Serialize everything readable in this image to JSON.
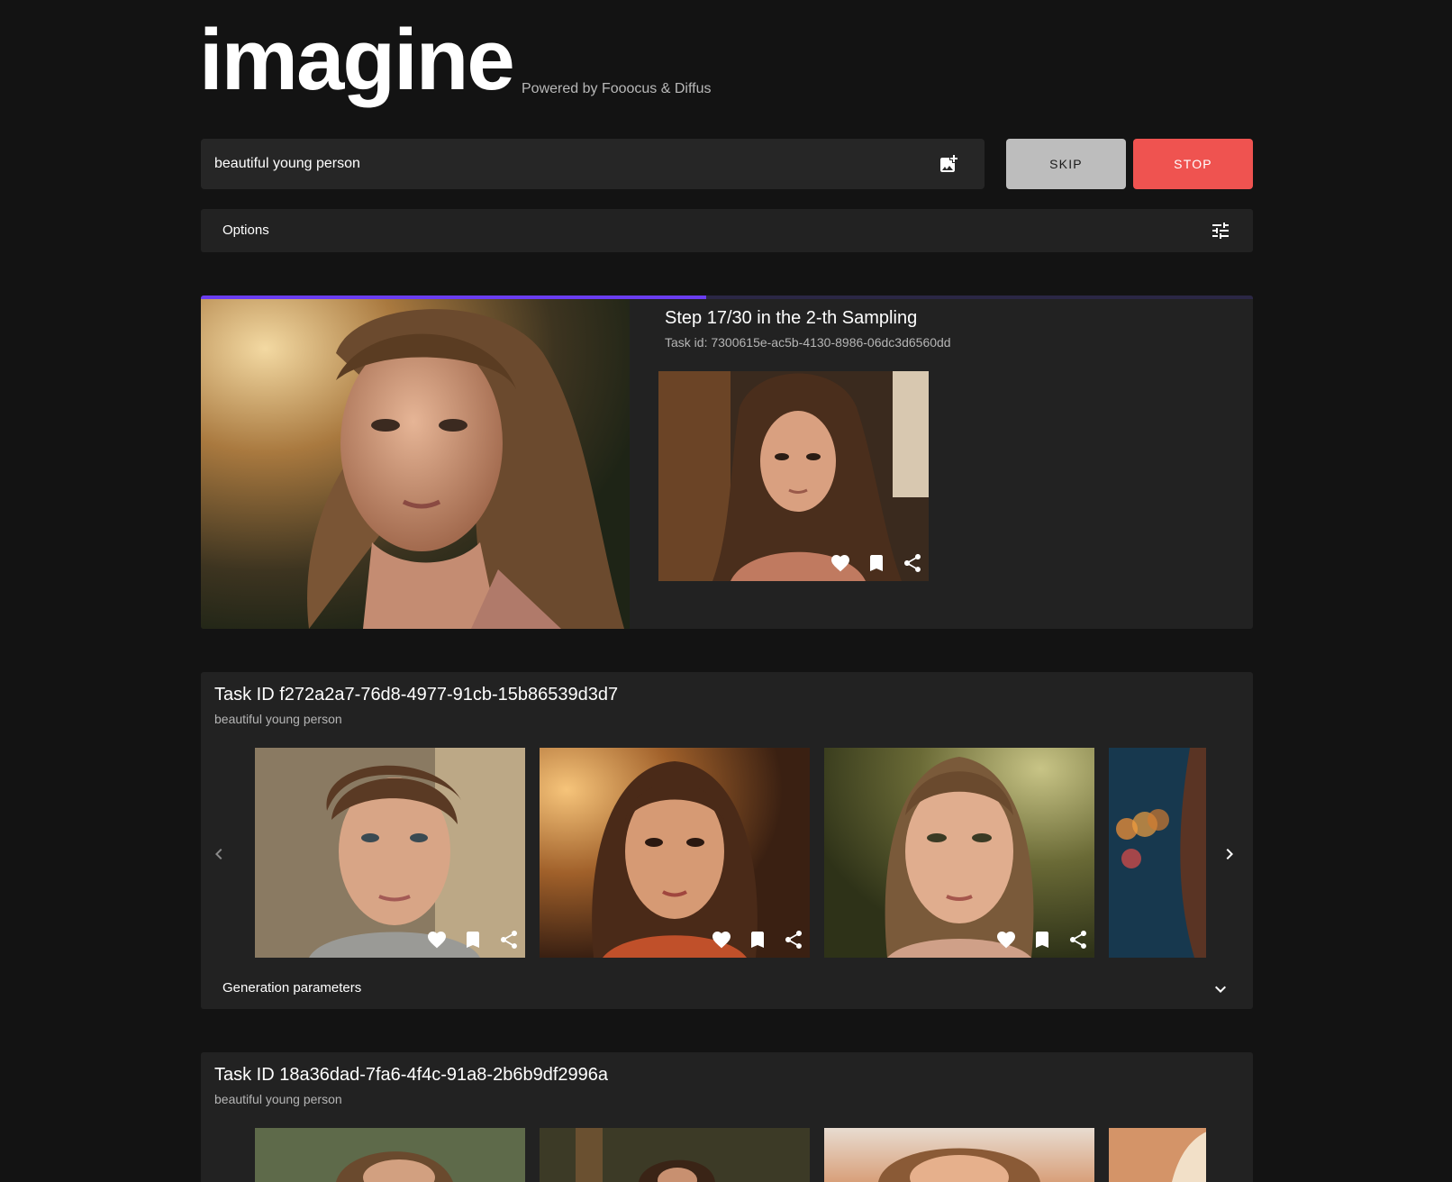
{
  "app": {
    "logo": "imagine",
    "powered_by": "Powered by Fooocus & Diffus"
  },
  "prompt": {
    "value": "beautiful young person",
    "add_image_icon": "add-photo-icon"
  },
  "buttons": {
    "skip": "SKIP",
    "stop": "STOP"
  },
  "options": {
    "label": "Options",
    "icon": "tune-icon"
  },
  "current_task": {
    "step_text": "Step 17/30 in the 2-th Sampling",
    "task_id_text": "Task id: 7300615e-ac5b-4130-8986-06dc3d6560dd",
    "progress_fraction": 0.48,
    "progress_color": "#6a3df0"
  },
  "tasks": [
    {
      "title": "Task ID f272a2a7-76d8-4977-91cb-15b86539d3d7",
      "prompt": "beautiful young person",
      "gen_params_label": "Generation parameters"
    },
    {
      "title": "Task ID 18a36dad-7fa6-4f4c-91a8-2b6b9df2996a",
      "prompt": "beautiful young person"
    }
  ],
  "colors": {
    "background": "#131313",
    "card": "#222222",
    "skip_button": "#bdbdbd",
    "stop_button": "#ef5350"
  }
}
